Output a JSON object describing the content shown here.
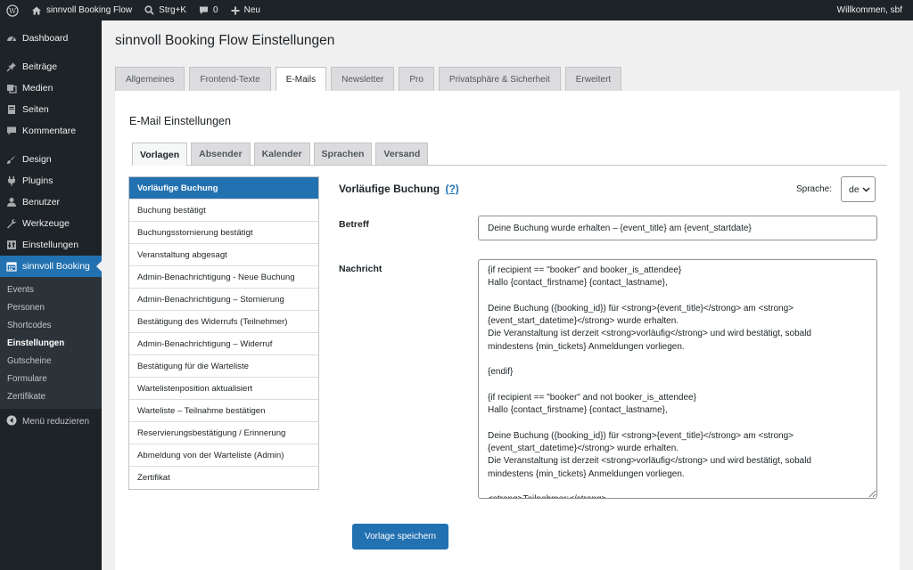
{
  "adminbar": {
    "site_name": "sinnvoll Booking Flow",
    "search_shortcut": "Strg+K",
    "comments_count": "0",
    "new_label": "Neu",
    "welcome": "Willkommen, sbf"
  },
  "sidebar": {
    "items": [
      {
        "label": "Dashboard",
        "icon": "dashboard-icon"
      },
      {
        "label": "Beiträge",
        "icon": "pin-icon"
      },
      {
        "label": "Medien",
        "icon": "media-icon"
      },
      {
        "label": "Seiten",
        "icon": "page-icon"
      },
      {
        "label": "Kommentare",
        "icon": "comment-icon"
      },
      {
        "label": "Design",
        "icon": "brush-icon"
      },
      {
        "label": "Plugins",
        "icon": "plugin-icon"
      },
      {
        "label": "Benutzer",
        "icon": "user-icon"
      },
      {
        "label": "Werkzeuge",
        "icon": "wrench-icon"
      },
      {
        "label": "Einstellungen",
        "icon": "settings-icon"
      },
      {
        "label": "sinnvoll Booking",
        "icon": "calendar-icon"
      }
    ],
    "submenu": [
      "Events",
      "Personen",
      "Shortcodes",
      "Einstellungen",
      "Gutscheine",
      "Formulare",
      "Zertifikate"
    ],
    "collapse_label": "Menü reduzieren"
  },
  "page": {
    "title": "sinnvoll Booking Flow Einstellungen",
    "tabs": [
      "Allgemeines",
      "Frontend-Texte",
      "E-Mails",
      "Newsletter",
      "Pro",
      "Privatsphäre & Sicherheit",
      "Erweitert"
    ],
    "active_tab": "E-Mails"
  },
  "email": {
    "section_title": "E-Mail Einstellungen",
    "subtabs": [
      "Vorlagen",
      "Absender",
      "Kalender",
      "Sprachen",
      "Versand"
    ],
    "templates": [
      "Vorläufige Buchung",
      "Buchung bestätigt",
      "Buchungsstornierung bestätigt",
      "Veranstaltung abgesagt",
      "Admin-Benachrichtigung - Neue Buchung",
      "Admin-Benachrichtigung – Stornierung",
      "Bestätigung des Widerrufs (Teilnehmer)",
      "Admin-Benachrichtigung – Widerruf",
      "Bestätigung für die Warteliste",
      "Wartelistenposition aktualisiert",
      "Warteliste – Teilnahme bestätigen",
      "Reservierungsbestätigung / Erinnerung",
      "Abmeldung von der Warteliste (Admin)",
      "Zertifikat"
    ],
    "editor": {
      "title": "Vorläufige Buchung",
      "help": "(?)",
      "language_label": "Sprache:",
      "language_value": "de",
      "subject_label": "Betreff",
      "subject_value": "Deine Buchung wurde erhalten – {event_title} am {event_startdate}",
      "message_label": "Nachricht",
      "message_value": "{if recipient == \"booker\" and booker_is_attendee}\nHallo {contact_firstname} {contact_lastname},\n\nDeine Buchung ({booking_id}) für <strong>{event_title}</strong> am <strong>\n{event_start_datetime}</strong> wurde erhalten.\nDie Veranstaltung ist derzeit <strong>vorläufig</strong> und wird bestätigt, sobald\nmindestens {min_tickets} Anmeldungen vorliegen.\n\n{endif}\n\n{if recipient == \"booker\" and not booker_is_attendee}\nHallo {contact_firstname} {contact_lastname},\n\nDeine Buchung ({booking_id}) für <strong>{event_title}</strong> am <strong>\n{event_start_datetime}</strong> wurde erhalten.\nDie Veranstaltung ist derzeit <strong>vorläufig</strong> und wird bestätigt, sobald\nmindestens {min_tickets} Anmeldungen vorliegen.\n\n<strong>Teilnehmer:</strong>",
      "save_label": "Vorlage speichern"
    }
  },
  "colors": {
    "accent": "#2271b1",
    "sidebar_bg": "#1d2327",
    "submenu_bg": "#2c3338",
    "page_bg": "#f0f0f1"
  }
}
